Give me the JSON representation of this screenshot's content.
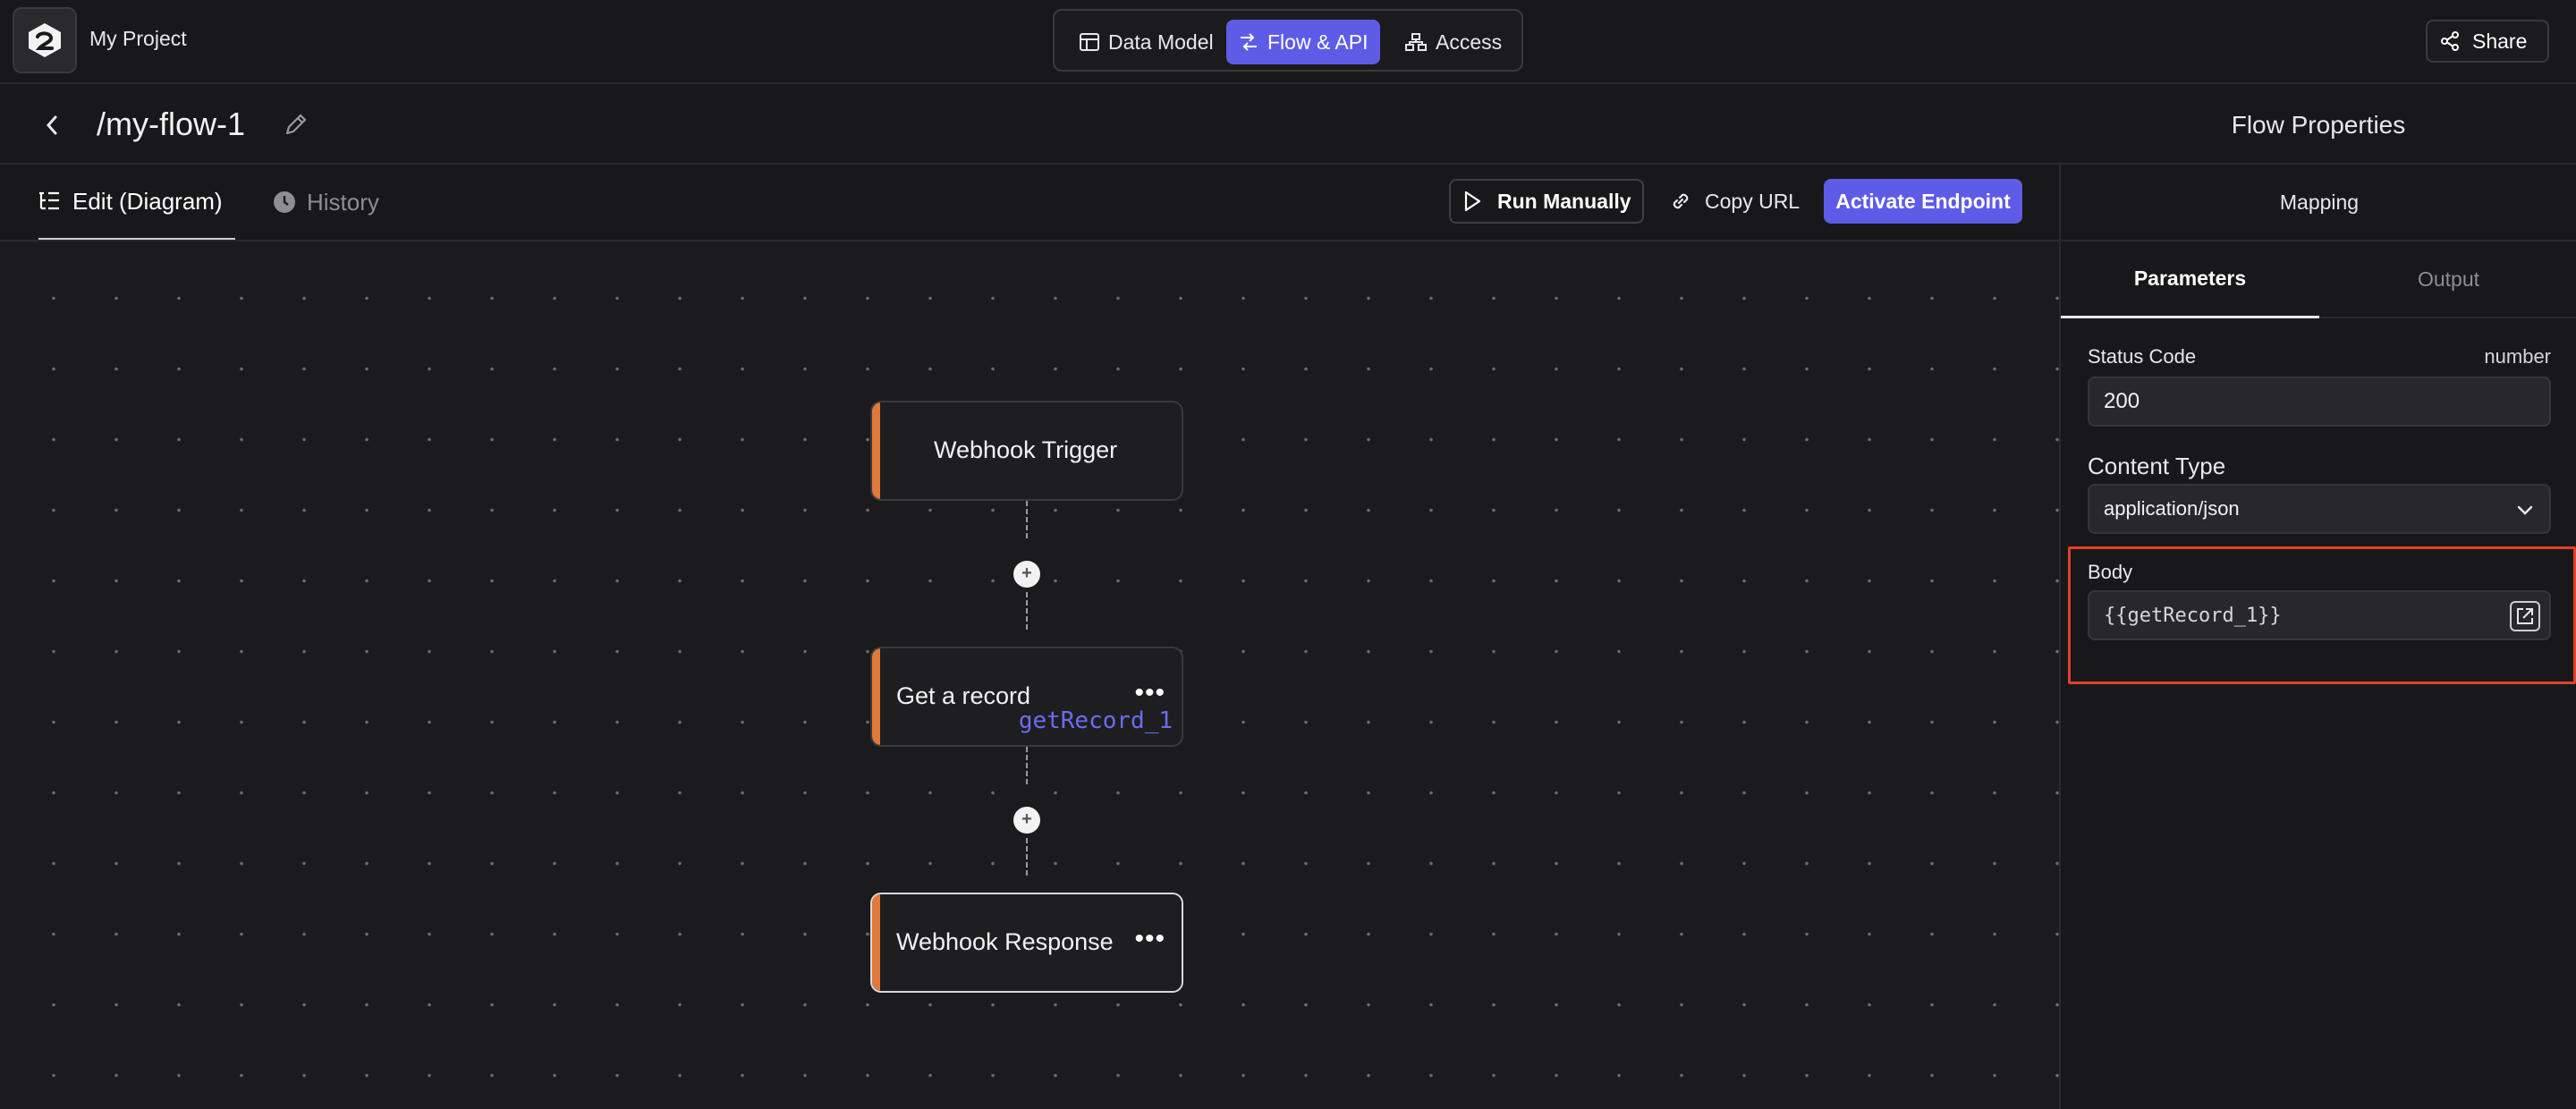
{
  "header": {
    "project_name": "My Project",
    "nav": [
      {
        "label": "Data Model",
        "icon": "table-icon",
        "active": false
      },
      {
        "label": "Flow & API",
        "icon": "flow-icon",
        "active": true
      },
      {
        "label": "Access",
        "icon": "sitemap-icon",
        "active": false
      }
    ],
    "share_label": "Share",
    "accent_color": "#5e5ce6"
  },
  "titlebar": {
    "flow_title": "/my-flow-1",
    "panel_title": "Flow Properties"
  },
  "tabs": {
    "edit_label": "Edit (Diagram)",
    "history_label": "History"
  },
  "toolbar": {
    "run_label": "Run Manually",
    "copy_label": "Copy URL",
    "activate_label": "Activate Endpoint"
  },
  "nodes": [
    {
      "label": "Webhook Trigger",
      "accent": "#e0793a"
    },
    {
      "label": "Get a record",
      "var": "getRecord_1",
      "accent": "#e0793a"
    },
    {
      "label": "Webhook Response",
      "accent": "#e0793a",
      "selected": true
    }
  ],
  "panel": {
    "mapping_label": "Mapping",
    "tabs": [
      "Parameters",
      "Output"
    ],
    "status_code_label": "Status Code",
    "status_code_type": "number",
    "status_code_value": "200",
    "content_type_label": "Content Type",
    "content_type_value": "application/json",
    "body_label": "Body",
    "body_value": "{{getRecord_1}}",
    "highlight_color": "#e1402a"
  }
}
